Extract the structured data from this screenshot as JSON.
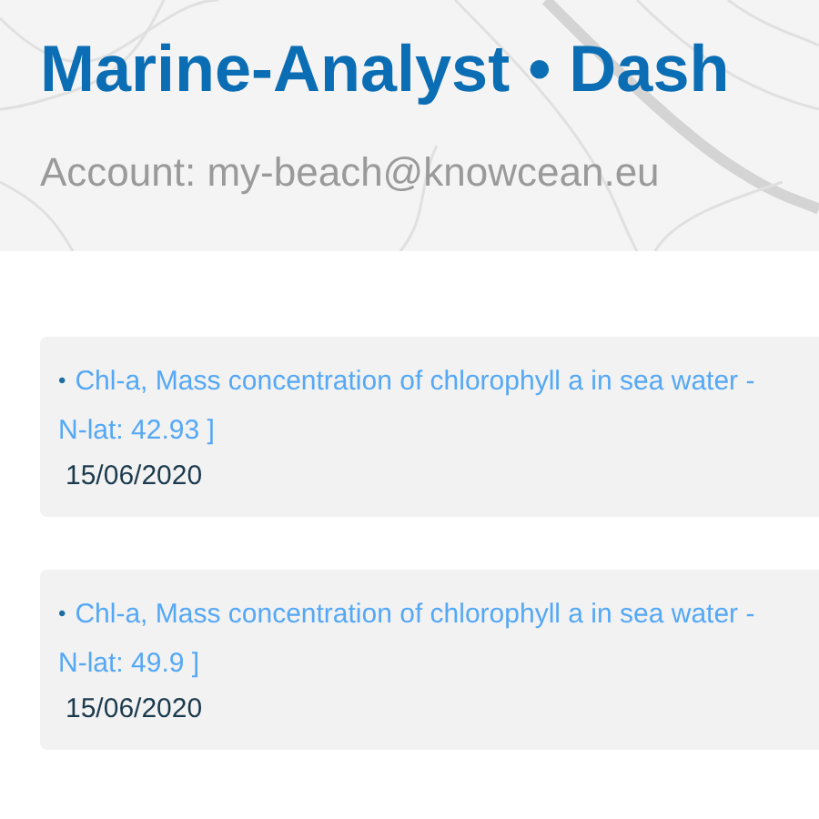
{
  "header": {
    "title": "Marine-Analyst • Dash",
    "account": "Account: my-beach@knowcean.eu"
  },
  "items": [
    {
      "bullet": "•",
      "link": "Chl-a, Mass concentration of chlorophyll a in sea water -",
      "link_continuation": "N-lat: 42.93 ]",
      "date": "15/06/2020"
    },
    {
      "bullet": "•",
      "link": "Chl-a, Mass concentration of chlorophyll a in sea water -",
      "link_continuation": "N-lat: 49.9 ]",
      "date": "15/06/2020"
    }
  ]
}
